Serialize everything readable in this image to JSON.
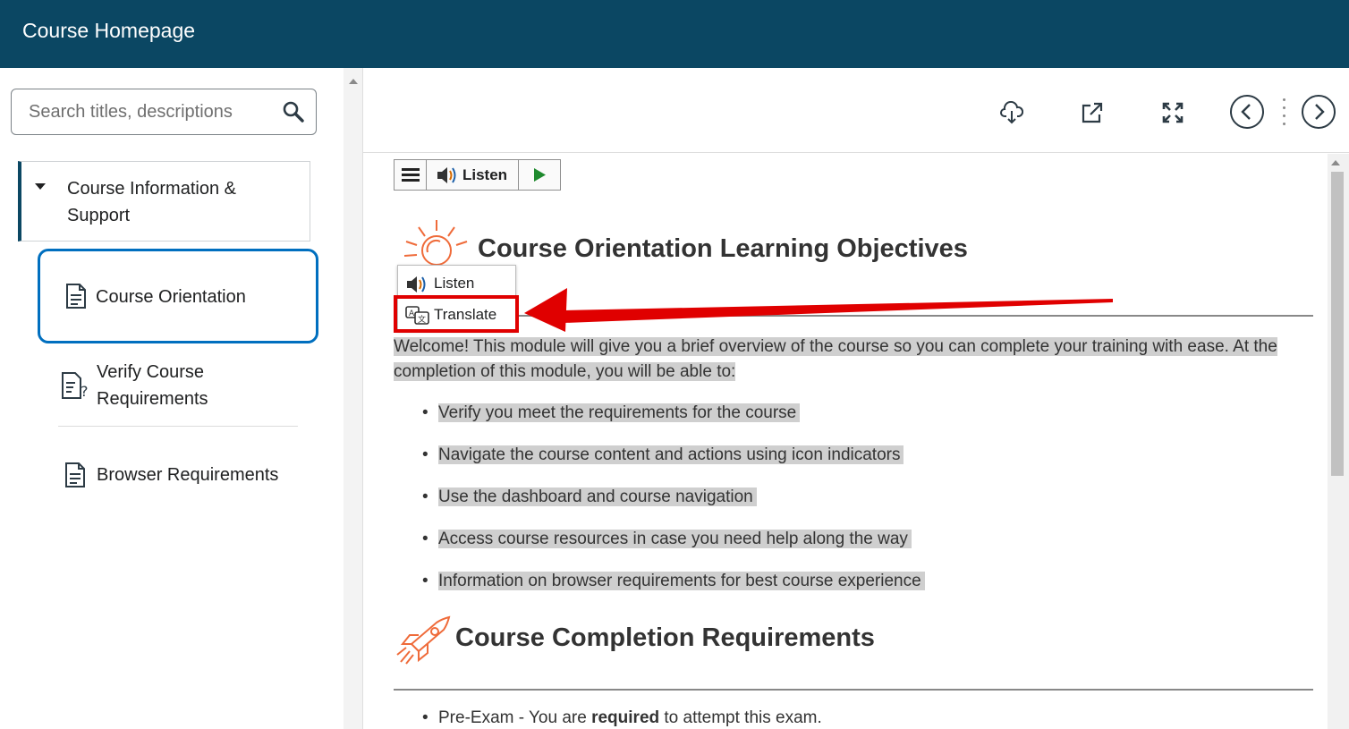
{
  "header": {
    "title": "Course Homepage",
    "bg_color": "#0b4763"
  },
  "sidebar": {
    "search_placeholder": "Search titles, descriptions",
    "unit_label": "Course Information & Support",
    "topics": [
      {
        "label": "Course Orientation",
        "icon": "document-icon",
        "active": true
      },
      {
        "label": "Verify Course Requirements",
        "icon": "checklist-question-icon"
      },
      {
        "label": "Browser Requirements",
        "icon": "document-icon"
      }
    ]
  },
  "toolbar": {
    "icons": [
      "download-cloud-icon",
      "open-external-icon",
      "fullscreen-icon",
      "previous-icon",
      "next-icon"
    ]
  },
  "readspeaker": {
    "listen_label": "Listen"
  },
  "content": {
    "heading1": "Course Orientation Learning Objectives",
    "popup": {
      "listen": "Listen",
      "translate": "Translate"
    },
    "intro": "Welcome! This module will give you a brief overview of the course so you can complete your training with ease. At the completion of this module, you will be able to:",
    "objectives": [
      "Verify you meet the requirements for the course",
      "Navigate the course content and actions using icon indicators",
      "Use the dashboard and course navigation",
      "Access course resources in case you need help along the way",
      "Information on browser requirements for best course experience"
    ],
    "heading2": "Course Completion Requirements",
    "req_prefix": "Pre-Exam - You are ",
    "req_bold": "required",
    "req_suffix": " to attempt this exam."
  },
  "colors": {
    "accent": "#006fbf",
    "annotation": "#e00000",
    "highlight": "#cfcfcf"
  }
}
